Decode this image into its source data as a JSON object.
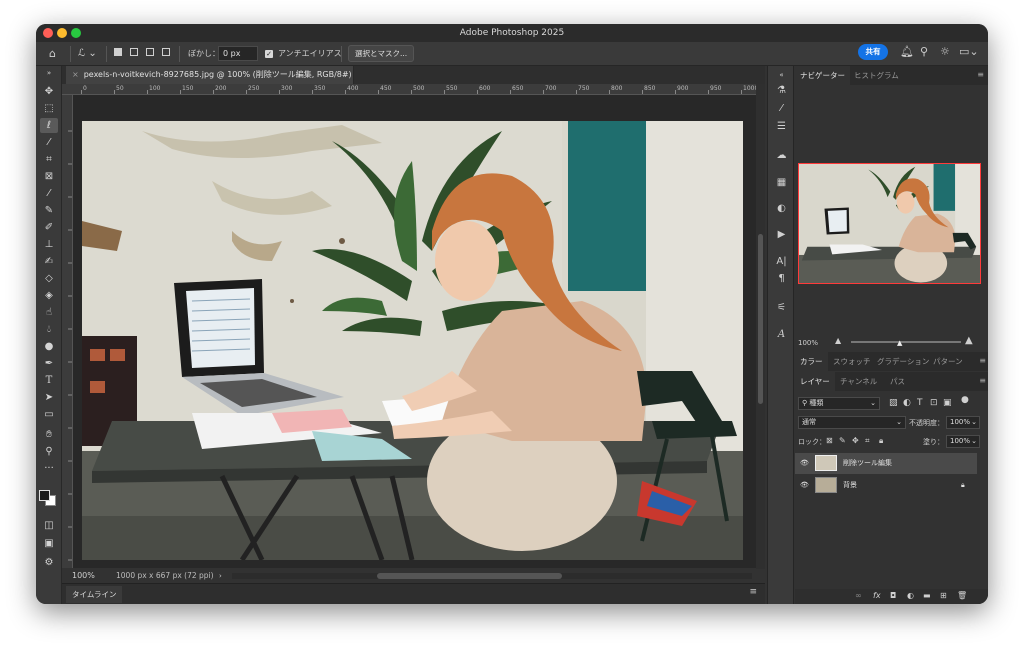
{
  "app": {
    "title": "Adobe Photoshop 2025"
  },
  "options": {
    "feather_label": "ぼかし：",
    "feather_value": "0 px",
    "antialias_label": "アンチエイリアス",
    "select_mask_button": "選択とマスク...",
    "share_button": "共有"
  },
  "document": {
    "tab_title": "pexels-n-voitkevich-8927685.jpg @ 100% (削除ツール編集, RGB/8#) *",
    "zoom": "100%",
    "size_info": "1000 px x 667 px (72 ppi)",
    "ruler_ticks": [
      "0",
      "50",
      "100",
      "150",
      "200",
      "250",
      "300",
      "350",
      "400",
      "450",
      "500",
      "550",
      "600",
      "650",
      "700",
      "750",
      "800",
      "850",
      "900",
      "950",
      "1000"
    ]
  },
  "timeline": {
    "label": "タイムライン"
  },
  "navigator": {
    "tabs": [
      "ナビゲーター",
      "ヒストグラム"
    ],
    "zoom": "100%"
  },
  "color_panel": {
    "tabs": [
      "カラー",
      "スウォッチ",
      "グラデーション",
      "パターン"
    ]
  },
  "layers_panel": {
    "tabs": [
      "レイヤー",
      "チャンネル",
      "パス"
    ],
    "filter_kind": "種類",
    "blend_mode": "通常",
    "opacity_label": "不透明度：",
    "opacity_value": "100%",
    "lock_label": "ロック：",
    "fill_label": "塗り：",
    "fill_value": "100%",
    "layers": [
      {
        "name": "削除ツール編集",
        "selected": true,
        "locked": false
      },
      {
        "name": "背景",
        "selected": false,
        "locked": true
      }
    ]
  },
  "colors": {
    "accent": "#1473e6",
    "window_bg": "#323232",
    "nav_frame": "#ff3a3a"
  },
  "icons": {
    "tools": [
      "move-icon",
      "marquee-icon",
      "lasso-icon",
      "magic-wand-icon",
      "crop-icon",
      "frame-icon",
      "eyedropper-icon",
      "healing-brush-icon",
      "brush-icon",
      "stamp-icon",
      "history-brush-icon",
      "eraser-icon",
      "paint-bucket-icon",
      "smudge-icon",
      "dodge-icon",
      "pen-icon",
      "type-icon",
      "path-select-icon",
      "rectangle-icon",
      "hand-icon",
      "zoom-icon",
      "more-tools-icon"
    ]
  }
}
